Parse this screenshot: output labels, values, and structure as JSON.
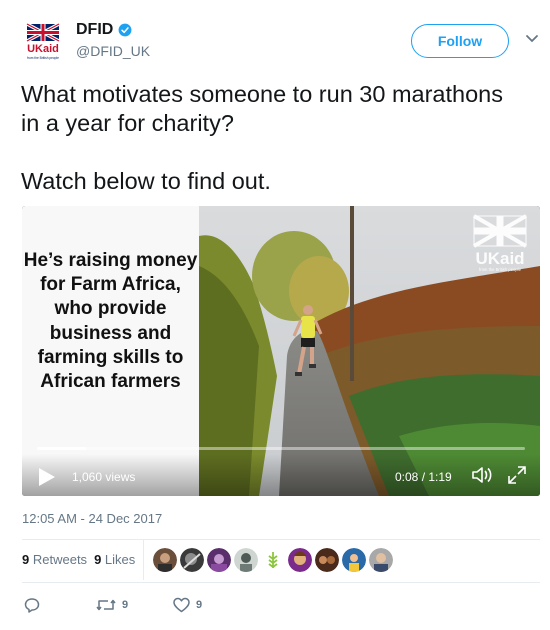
{
  "account": {
    "display_name": "DFID",
    "handle": "@DFID_UK",
    "verified_icon": "verified-badge-icon",
    "logo": "ukaid-logo",
    "logo_text": "UKaid",
    "logo_tagline": "from the British people"
  },
  "follow_label": "Follow",
  "menu_icon": "chevron-down-icon",
  "tweet": {
    "line1": "What motivates someone to run 30 marathons in a year for charity?",
    "line2": "Watch below to find out."
  },
  "video": {
    "caption": "He’s raising money for Farm Africa, who provide business and farming skills to African farmers",
    "views": "1,060 views",
    "time": "0:08 / 1:19",
    "progress": 0.101,
    "logo_text": "UKaid",
    "logo_tagline": "from the British people"
  },
  "timestamp": "12:05 AM - 24 Dec 2017",
  "stats": {
    "retweets_count": "9",
    "retweets_label": "Retweets",
    "likes_count": "9",
    "likes_label": "Likes"
  },
  "actions": {
    "reply_icon": "reply-icon",
    "retweet_count": "9",
    "like_count": "9"
  },
  "colors": {
    "accent": "#1da1f2",
    "text_secondary": "#657786",
    "verified": "#1da1f2"
  }
}
